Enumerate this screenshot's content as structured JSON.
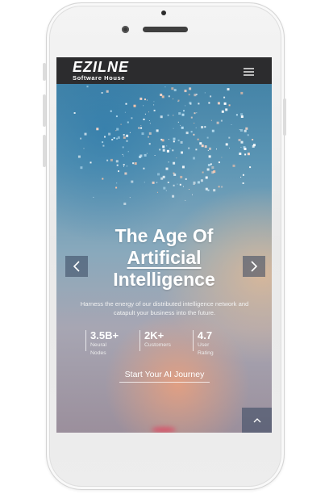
{
  "brand": {
    "name": "EZILNE",
    "tagline": "Software House"
  },
  "nav": {
    "menu_icon": "hamburger-menu-icon"
  },
  "hero": {
    "title_line1": "The Age Of",
    "title_line2": "Artificial",
    "title_line3": "Intelligence",
    "description": "Harness the energy of our distributed intelligence network and catapult your business into the future.",
    "cta_label": "Start Your AI Journey",
    "prev_icon": "chevron-left-icon",
    "next_icon": "chevron-right-icon"
  },
  "stats": [
    {
      "value": "3.5B+",
      "label": "Neural Nodes"
    },
    {
      "value": "2K+",
      "label": "Customers"
    },
    {
      "value": "4.7",
      "label": "User Rating"
    }
  ],
  "scroll_top_icon": "chevron-up-icon",
  "colors": {
    "navbar": "#2c2c2e",
    "text": "#ffffff",
    "sky_top": "#3d7ea3",
    "warm_glow": "#eba07d"
  }
}
